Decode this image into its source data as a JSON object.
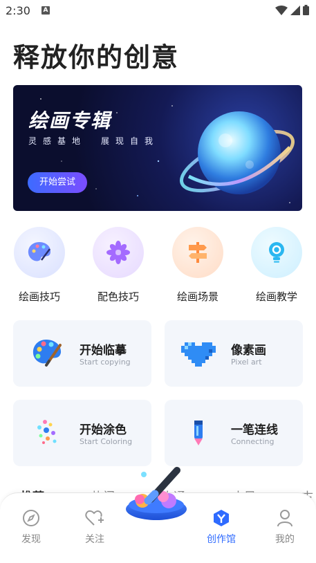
{
  "status": {
    "time": "2:30",
    "notif": "A"
  },
  "header": {
    "title": "释放你的创意"
  },
  "banner": {
    "title": "绘画专辑",
    "subtitle": "灵感基地　展现自我",
    "button": "开始尝试"
  },
  "categories": [
    {
      "label": "绘画技巧",
      "icon": "palette-icon"
    },
    {
      "label": "配色技巧",
      "icon": "flower-icon"
    },
    {
      "label": "绘画场景",
      "icon": "signpost-icon"
    },
    {
      "label": "绘画教学",
      "icon": "lightbulb-icon"
    }
  ],
  "cards": [
    {
      "title": "开始临摹",
      "subtitle": "Start copying",
      "icon": "palette-brush-icon"
    },
    {
      "title": "像素画",
      "subtitle": "Pixel art",
      "icon": "pixel-heart-icon"
    },
    {
      "title": "开始涂色",
      "subtitle": "Start Coloring",
      "icon": "color-dots-icon"
    },
    {
      "title": "一笔连线",
      "subtitle": "Connecting",
      "icon": "pen-line-icon"
    }
  ],
  "tabs": [
    "推荐",
    "热门",
    "卡通",
    "古风",
    "古"
  ],
  "nav": [
    {
      "label": "发现",
      "icon": "compass-icon"
    },
    {
      "label": "关注",
      "icon": "heart-plus-icon"
    },
    {
      "label": "创作馆",
      "icon": "studio-icon"
    },
    {
      "label": "我的",
      "icon": "user-icon"
    }
  ],
  "colors": {
    "accent": "#2f6bff",
    "card_bg": "#f3f6fb",
    "banner_bg": "#0b0e2e"
  }
}
